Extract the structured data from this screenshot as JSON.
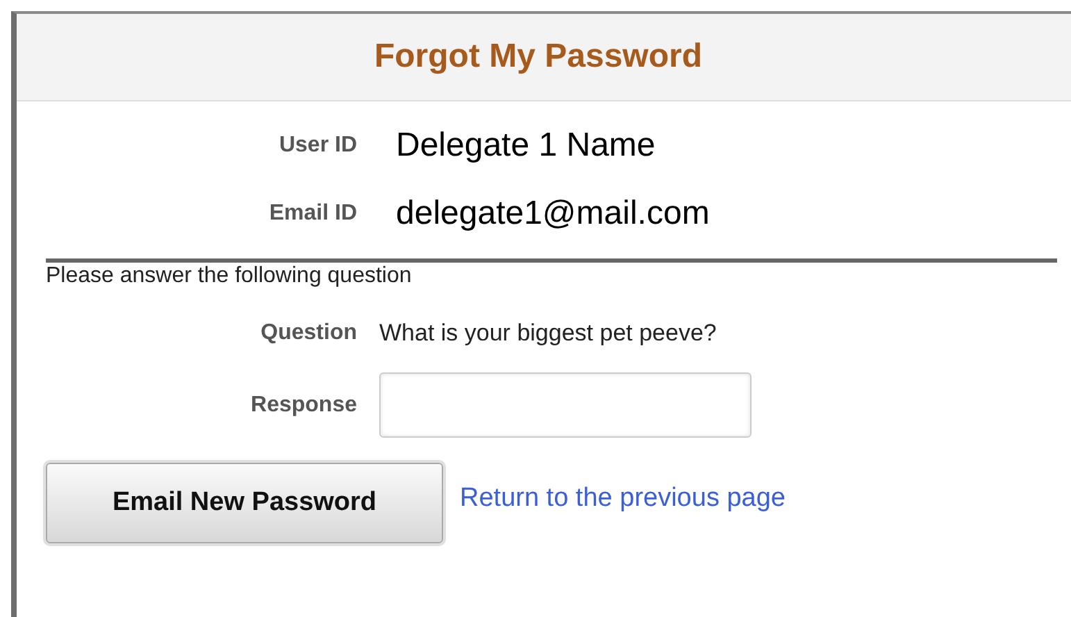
{
  "header": {
    "title": "Forgot My Password"
  },
  "identity": [
    {
      "label": "User ID",
      "value": "Delegate 1 Name"
    },
    {
      "label": "Email ID",
      "value": "delegate1@mail.com"
    }
  ],
  "instruction": "Please answer the following question",
  "question": {
    "label": "Question",
    "text": "What is your biggest pet peeve?"
  },
  "response": {
    "label": "Response"
  },
  "submit_button": "Email New Password",
  "return_link": "Return to the previous page"
}
